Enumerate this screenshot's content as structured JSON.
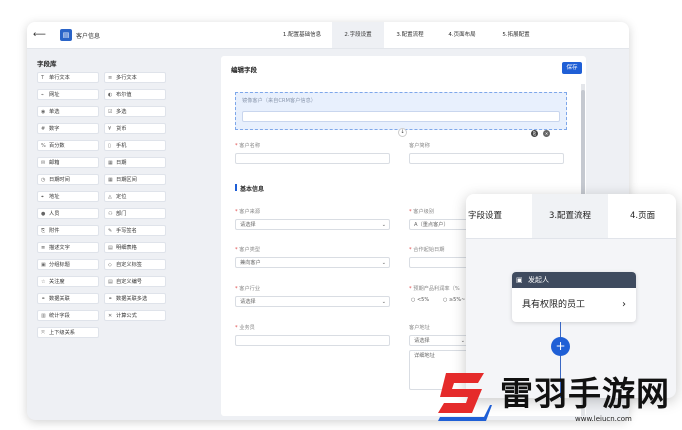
{
  "app": {
    "title": "客户信息"
  },
  "steps": [
    "1.配置基础信息",
    "2.字段设置",
    "3.配置流程",
    "4.页面布局",
    "5.拓展配置"
  ],
  "library": {
    "title": "字段库",
    "items": [
      {
        "label": "单行文本",
        "icon": "T"
      },
      {
        "label": "多行文本",
        "icon": "≡"
      },
      {
        "label": "网址",
        "icon": "⌁"
      },
      {
        "label": "布尔值",
        "icon": "◐"
      },
      {
        "label": "单选",
        "icon": "◉"
      },
      {
        "label": "多选",
        "icon": "☑"
      },
      {
        "label": "数字",
        "icon": "#"
      },
      {
        "label": "货币",
        "icon": "¥"
      },
      {
        "label": "百分数",
        "icon": "%"
      },
      {
        "label": "手机",
        "icon": "▯"
      },
      {
        "label": "邮箱",
        "icon": "✉"
      },
      {
        "label": "日期",
        "icon": "▦"
      },
      {
        "label": "日期时间",
        "icon": "◷"
      },
      {
        "label": "日期区间",
        "icon": "▦"
      },
      {
        "label": "地址",
        "icon": "⌖"
      },
      {
        "label": "定位",
        "icon": "◬"
      },
      {
        "label": "人员",
        "icon": "●"
      },
      {
        "label": "部门",
        "icon": "⚇"
      },
      {
        "label": "附件",
        "icon": "⎘"
      },
      {
        "label": "手写签名",
        "icon": "✎"
      },
      {
        "label": "描述文字",
        "icon": "≣"
      },
      {
        "label": "明细表格",
        "icon": "▤"
      },
      {
        "label": "分组标题",
        "icon": "▣"
      },
      {
        "label": "自定义标签",
        "icon": "◇"
      },
      {
        "label": "关注度",
        "icon": "☆"
      },
      {
        "label": "自定义编号",
        "icon": "▤"
      },
      {
        "label": "数据关联",
        "icon": "⚭"
      },
      {
        "label": "数据关联多选",
        "icon": "⚭"
      },
      {
        "label": "统计字段",
        "icon": "▥"
      },
      {
        "label": "计算公式",
        "icon": "✕"
      },
      {
        "label": "上下级关系",
        "icon": "⤧"
      }
    ]
  },
  "editor": {
    "title": "编辑字段",
    "save_label": "保存",
    "mirror_label": "镜像客户（来自CRM客户信息）",
    "fields": {
      "customer_name": "客户名称",
      "customer_short": "客户简称",
      "section_basic": "基本信息",
      "customer_source": "客户来源",
      "customer_source_ph": "请选择",
      "customer_level": "客户级别",
      "customer_level_val": "A（重点客户）",
      "customer_type": "客户类型",
      "customer_type_val": "兼向客户",
      "start_date": "合作起始日期",
      "industry": "客户行业",
      "industry_ph": "请选择",
      "profit_rate": "预期产品利润率（%",
      "radio_1": "<5%",
      "radio_2": "≥5%~",
      "salesman": "业务员",
      "address": "客户地址",
      "address_ph": "请选择",
      "address_detail_ph": "详细地址"
    }
  },
  "overlay": {
    "tabs": [
      "字段设置",
      "3.配置流程",
      "4.页面"
    ],
    "card_title": "发起人",
    "card_body": "具有权限的员工"
  },
  "watermark": {
    "text": "雷羽手游网",
    "url": "www.leiucn.com"
  },
  "colors": {
    "accent": "#1f5fd6",
    "card_header": "#3f4b5f",
    "required": "#e04848"
  }
}
